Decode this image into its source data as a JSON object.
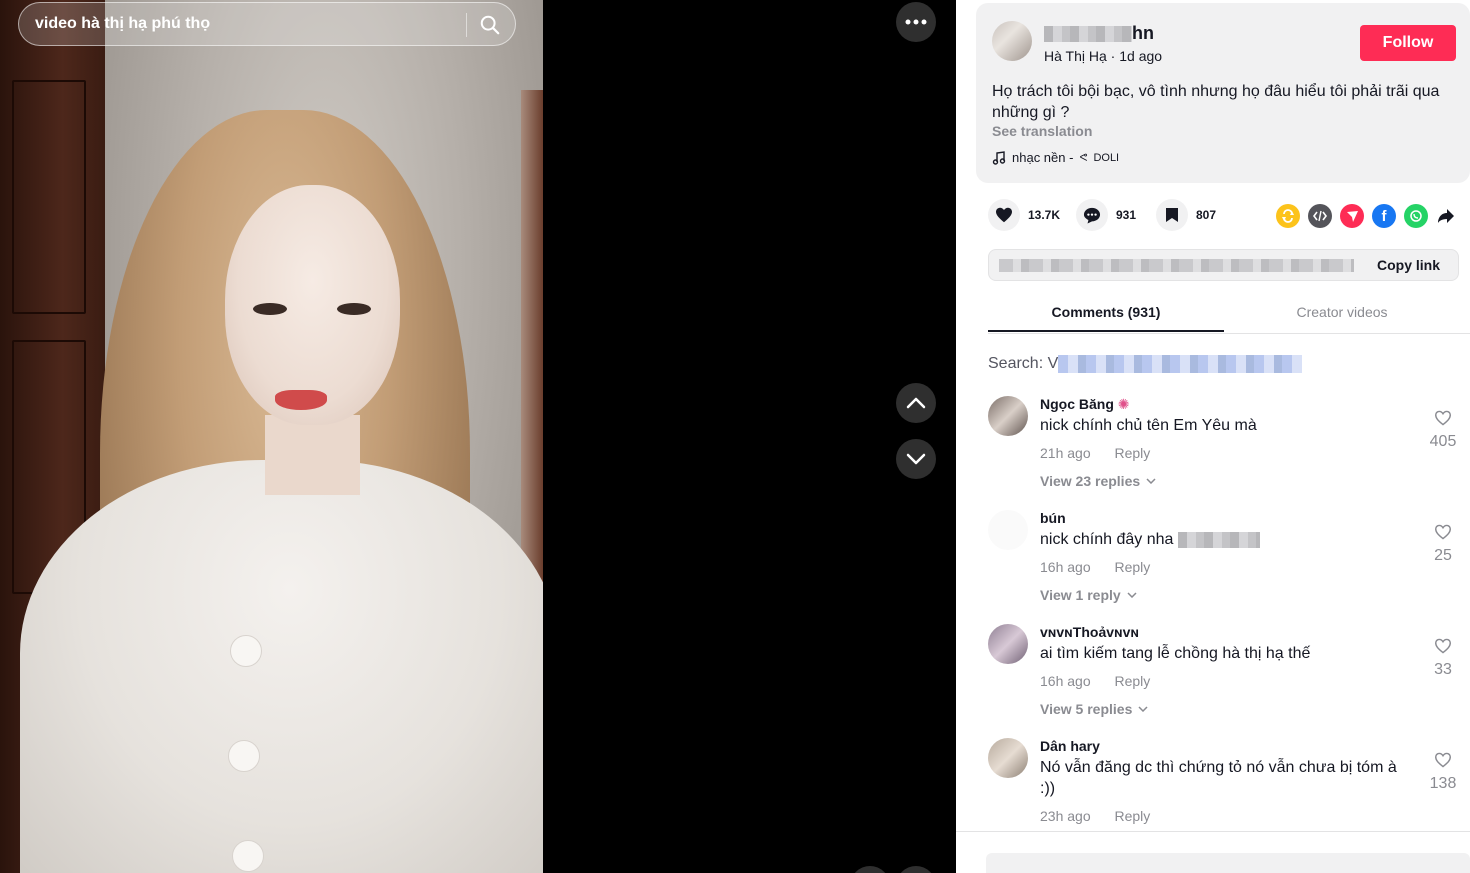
{
  "search": {
    "query": "video hà thị hạ phú thọ"
  },
  "author": {
    "username_visible": "hn",
    "nickname": "Hà Thị Hạ",
    "posted": "1d ago",
    "follow_label": "Follow"
  },
  "post": {
    "caption": "Họ trách tôi bội bạc, vô tình nhưng họ đâu hiểu tôi phải trãi qua những gì ?",
    "see_translation": "See translation",
    "music_title": "nhạc nền - ",
    "music_artist": "DOLI"
  },
  "stats": {
    "likes": "13.7K",
    "comments": "931",
    "saves": "807"
  },
  "share": {
    "copy_link_label": "Copy link",
    "colors": {
      "repost": "#fcc31b",
      "embed": "#54545a",
      "send": "#fe2c55",
      "facebook": "#1877f2",
      "whatsapp": "#25d366"
    }
  },
  "tabs": {
    "comments": "Comments (931)",
    "creator_videos": "Creator videos"
  },
  "comment_search": {
    "label": "Search: V"
  },
  "comments": [
    {
      "user": "Ngọc Băng",
      "text": "nick chính chủ tên Em Yêu mà",
      "time": "21h ago",
      "reply_label": "Reply",
      "view_replies": "View 23 replies",
      "likes": "405"
    },
    {
      "user": "bún",
      "text": "nick chính đây nha",
      "time": "16h ago",
      "reply_label": "Reply",
      "view_replies": "View 1 reply",
      "likes": "25"
    },
    {
      "user": "ᴠɴᴠɴThoảᴠɴᴠɴ",
      "text": "ai tìm kiếm tang lễ chồng hà thị hạ thế",
      "time": "16h ago",
      "reply_label": "Reply",
      "view_replies": "View 5 replies",
      "likes": "33"
    },
    {
      "user": "Dân hary",
      "text": "Nó vẫn đăng dc thì chứng tỏ nó vẫn chưa bị tóm à :))",
      "time": "23h ago",
      "reply_label": "Reply",
      "likes": "138"
    }
  ],
  "colors": {
    "accent": "#fe2c55",
    "text": "#161823",
    "muted": "#8a8b91"
  }
}
